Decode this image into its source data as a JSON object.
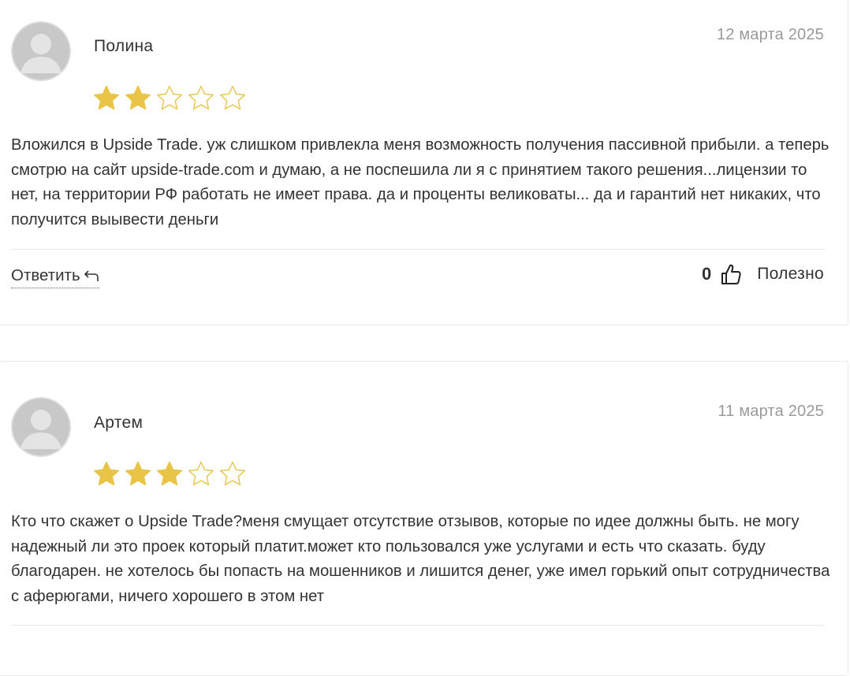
{
  "reviews": [
    {
      "author": "Полина",
      "date": "12 марта 2025",
      "rating": 2,
      "max_rating": 5,
      "text": "Вложился в Upside Trade. уж слишком привлекла меня возможность получения пассивной прибыли. а теперь смотрю на сайт upside-trade.com и думаю, а не поспешила ли я с принятием такого решения...лицензии то нет, на территории РФ работать не имеет права. да и проценты великоваты... да и гарантий нет никаких, что получится выывести деньги",
      "reply_label": "Ответить",
      "likes": "0",
      "useful_label": "Полезно"
    },
    {
      "author": "Артем",
      "date": "11 марта 2025",
      "rating": 3,
      "max_rating": 5,
      "text": "Кто что скажет о Upside Trade?меня смущает отсутствие отзывов, которые по идее должны быть. не могу надежный ли это проек который платит.может кто пользовался уже услугами и есть что сказать. буду благодарен. не хотелось бы попасть на мошенников и лишится денег, уже имел горький опыт сотрудничества с аферюгами, ничего хорошего в этом нет"
    }
  ],
  "colors": {
    "star_filled": "#e8c547",
    "star_outline": "#e8c547",
    "date": "#9a9a9a",
    "text": "#333333",
    "border": "#e9e9e9"
  },
  "icons": {
    "avatar": "default-user-avatar-icon",
    "star": "star-icon",
    "reply": "reply-arrow-icon",
    "like": "thumbs-up-icon"
  }
}
